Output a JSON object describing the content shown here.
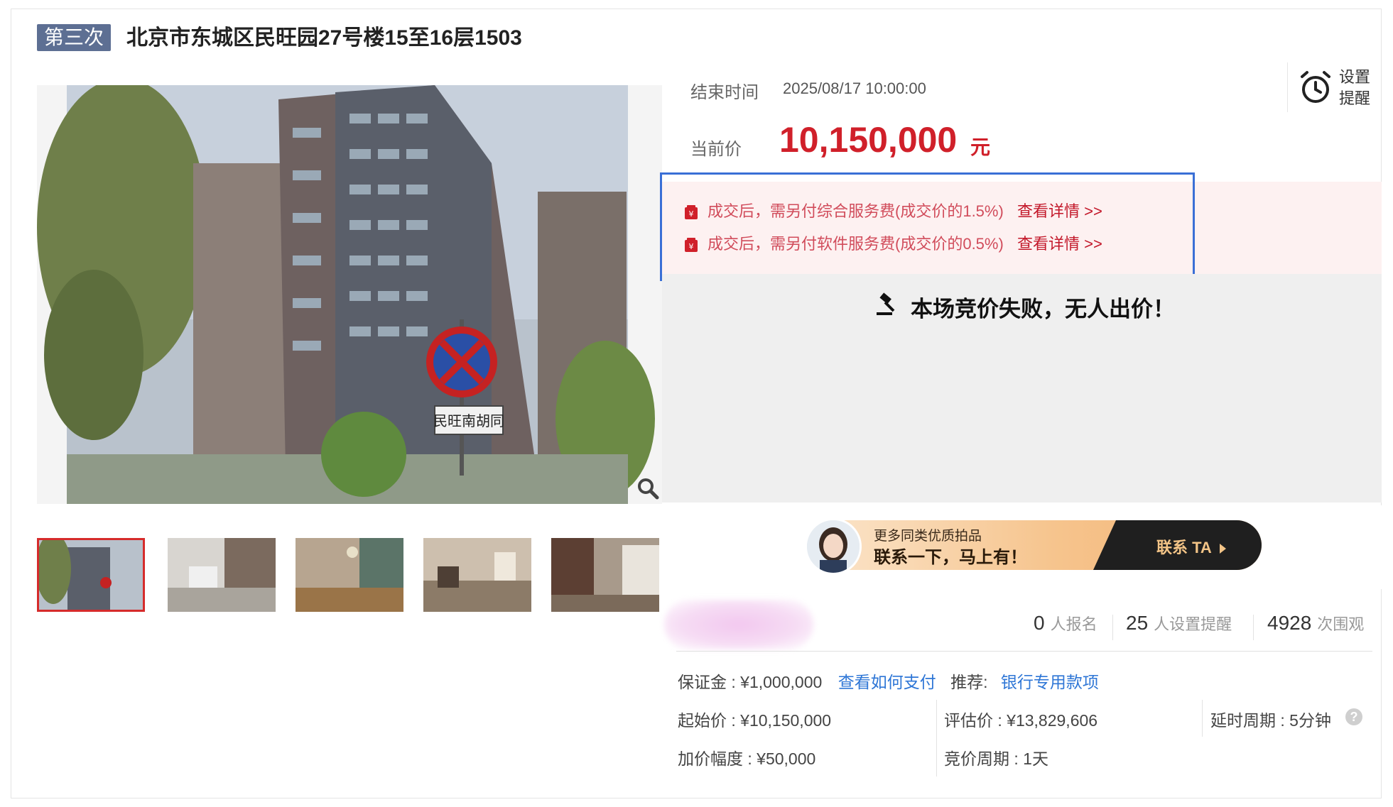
{
  "header": {
    "round_badge": "第三次",
    "title": "北京市东城区民旺园27号楼15至16层1503"
  },
  "gallery": {
    "main_image_sign_text": "民旺南胡同",
    "thumbnail_count": 5
  },
  "auction": {
    "end_time_label": "结束时间",
    "end_time_value": "2025/08/17 10:00:00",
    "current_price_label": "当前价",
    "current_price_value": "10,150,000",
    "current_price_unit": "元",
    "reminder_line1": "设置",
    "reminder_line2": "提醒"
  },
  "fees": [
    {
      "text": "成交后，需另付综合服务费(成交价的1.5%)",
      "link": "查看详情 >>"
    },
    {
      "text": "成交后，需另付软件服务费(成交价的0.5%)",
      "link": "查看详情 >>"
    }
  ],
  "status": {
    "fail_message": "本场竞价失败，无人出价！"
  },
  "contact": {
    "subtitle": "更多同类优质拍品",
    "main": "联系一下，马上有！",
    "button": "联系 TA"
  },
  "stats": {
    "registered_count": "0",
    "registered_label": "人报名",
    "reminder_count": "25",
    "reminder_label": "人设置提醒",
    "views_count": "4928",
    "views_label": "次围观"
  },
  "details": {
    "deposit": "保证金 : ¥1,000,000",
    "how_to_pay": "查看如何支付",
    "recommend_label": "推荐:",
    "recommend_link": "银行专用款项",
    "start_price": "起始价 : ¥10,150,000",
    "appraisal": "评估价 : ¥13,829,606",
    "delay_period": "延时周期 : 5分钟",
    "increment": "加价幅度 : ¥50,000",
    "bid_period": "竞价周期 : 1天"
  },
  "colors": {
    "price_red": "#d0202a",
    "link_blue": "#2e76d6",
    "badge_bg": "#5d6f93",
    "highlight_box": "#3a6fd6"
  }
}
